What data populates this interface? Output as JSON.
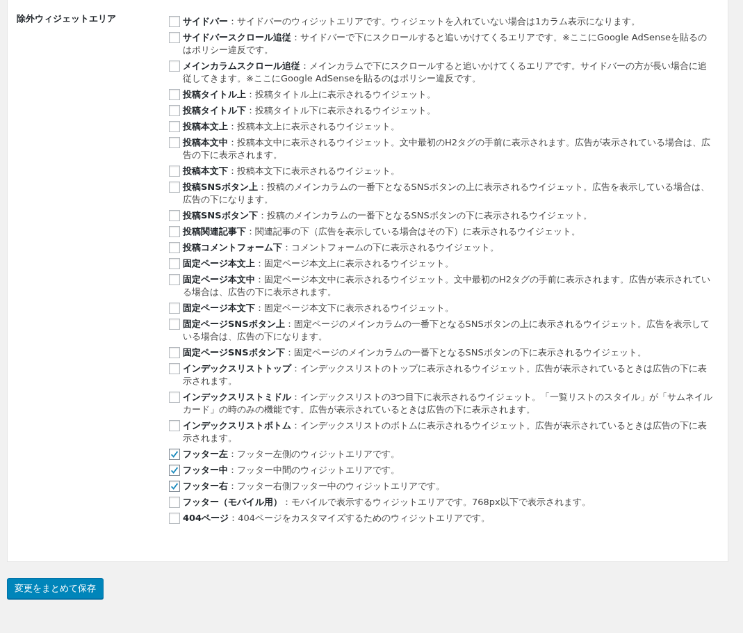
{
  "section": {
    "label": "除外ウィジェットエリア",
    "options": [
      {
        "text": "**サイドバー**：サイドバーのウィジットエリアです。ウィジェットを入れていない場合は1カラム表示になります。",
        "checked": false
      },
      {
        "text": "**サイドバースクロール追従**：サイドバーで下にスクロールすると追いかけてくるエリアです。※ここにGoogle AdSenseを貼るのはポリシー違反です。",
        "checked": false
      },
      {
        "text": "**メインカラムスクロール追従**：メインカラムで下にスクロールすると追いかけてくるエリアです。サイドバーの方が長い場合に追従してきます。※ここにGoogle AdSenseを貼るのはポリシー違反です。",
        "checked": false
      },
      {
        "text": "**投稿タイトル上**：投稿タイトル上に表示されるウイジェット。",
        "checked": false
      },
      {
        "text": "**投稿タイトル下**：投稿タイトル下に表示されるウイジェット。",
        "checked": false
      },
      {
        "text": "**投稿本文上**：投稿本文上に表示されるウイジェット。",
        "checked": false
      },
      {
        "text": "**投稿本文中**：投稿本文中に表示されるウイジェット。文中最初のH2タグの手前に表示されます。広告が表示されている場合は、広告の下に表示されます。",
        "checked": false
      },
      {
        "text": "**投稿本文下**：投稿本文下に表示されるウイジェット。",
        "checked": false
      },
      {
        "text": "**投稿SNSボタン上**：投稿のメインカラムの一番下となるSNSボタンの上に表示されるウイジェット。広告を表示している場合は、広告の下になります。",
        "checked": false
      },
      {
        "text": "**投稿SNSボタン下**：投稿のメインカラムの一番下となるSNSボタンの下に表示されるウイジェット。",
        "checked": false
      },
      {
        "text": "**投稿関連記事下**：関連記事の下（広告を表示している場合はその下）に表示されるウイジェット。",
        "checked": false
      },
      {
        "text": "**投稿コメントフォーム下**：コメントフォームの下に表示されるウイジェット。",
        "checked": false
      },
      {
        "text": "**固定ページ本文上**：固定ページ本文上に表示されるウイジェット。",
        "checked": false
      },
      {
        "text": "**固定ページ本文中**：固定ページ本文中に表示されるウイジェット。文中最初のH2タグの手前に表示されます。広告が表示されている場合は、広告の下に表示されます。",
        "checked": false
      },
      {
        "text": "**固定ページ本文下**：固定ページ本文下に表示されるウイジェット。",
        "checked": false
      },
      {
        "text": "**固定ページSNSボタン上**：固定ページのメインカラムの一番下となるSNSボタンの上に表示されるウイジェット。広告を表示している場合は、広告の下になります。",
        "checked": false
      },
      {
        "text": "**固定ページSNSボタン下**：固定ページのメインカラムの一番下となるSNSボタンの下に表示されるウイジェット。",
        "checked": false
      },
      {
        "text": "**インデックスリストトップ**：インデックスリストのトップに表示されるウイジェット。広告が表示されているときは広告の下に表示されます。",
        "checked": false
      },
      {
        "text": "**インデックスリストミドル**：インデックスリストの3つ目下に表示されるウイジェット。「一覧リストのスタイル」が「サムネイルカード」の時のみの機能です。広告が表示されているときは広告の下に表示されます。",
        "checked": false
      },
      {
        "text": "**インデックスリストボトム**：インデックスリストのボトムに表示されるウイジェット。広告が表示されているときは広告の下に表示されます。",
        "checked": false
      },
      {
        "text": "**フッター左**：フッター左側のウィジットエリアです。",
        "checked": true
      },
      {
        "text": "**フッター中**：フッター中間のウィジットエリアです。",
        "checked": true
      },
      {
        "text": "**フッター右**：フッター右側フッター中のウィジットエリアです。",
        "checked": true
      },
      {
        "text": "**フッター（モバイル用）**：モバイルで表示するウィジットエリアです。768px以下で表示されます。",
        "checked": false
      },
      {
        "text": "**404ページ**：404ページをカスタマイズするためのウィジットエリアです。",
        "checked": false
      }
    ]
  },
  "save_button": "変更をまとめて保存"
}
